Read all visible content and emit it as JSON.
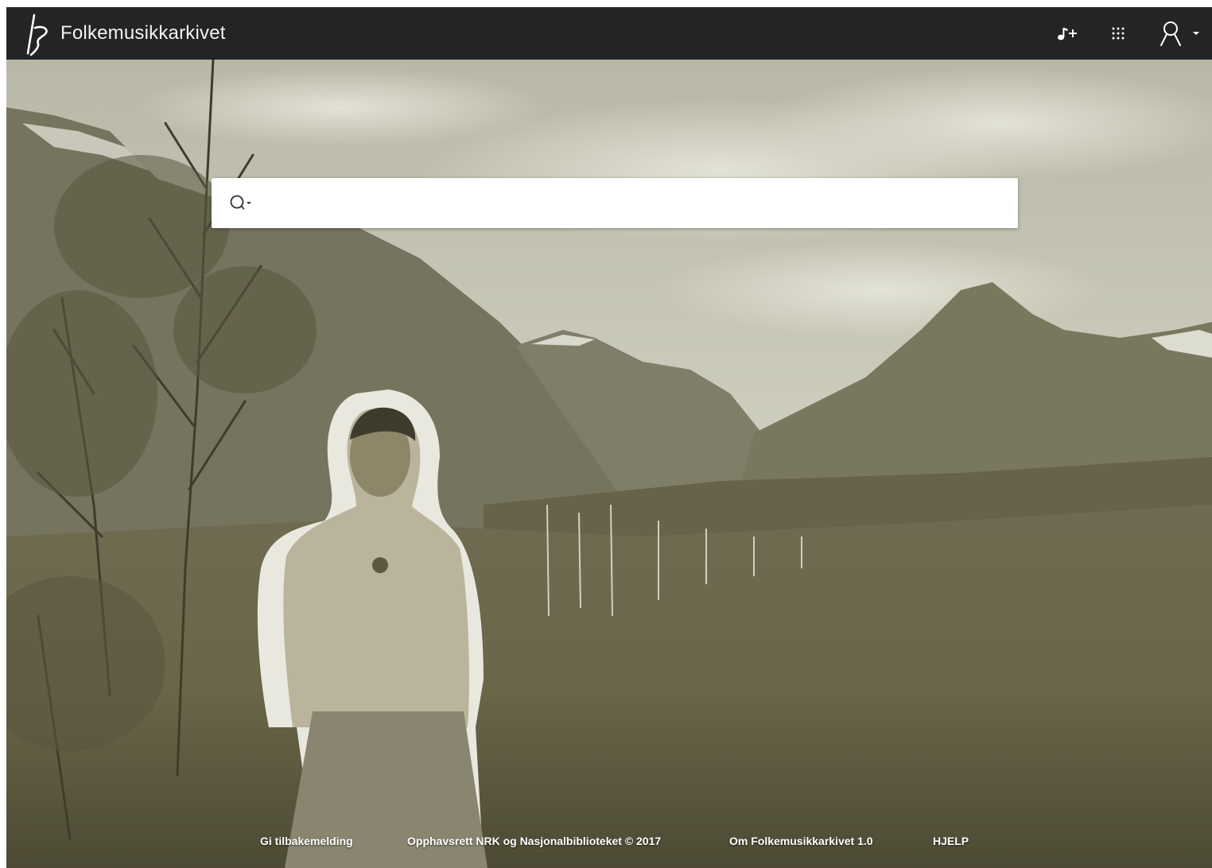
{
  "header": {
    "brand": "Folkemusikkarkivet",
    "logo_icon": "folkemusikk-logo-icon",
    "add_music_icon": "music-note-plus-icon",
    "apps_icon": "apps-grid-icon",
    "user_icon": "user-icon",
    "user_menu_icon": "caret-down-icon",
    "background_color": "#232425"
  },
  "search": {
    "placeholder": "",
    "value": "",
    "scope_icon": "search-icon"
  },
  "footer": {
    "feedback": "Gi tilbakemelding",
    "copyright": "Opphavsrett NRK og Nasjonalbiblioteket © 2017",
    "about": "Om Folkemusikkarkivet 1.0",
    "help": "HJELP"
  }
}
